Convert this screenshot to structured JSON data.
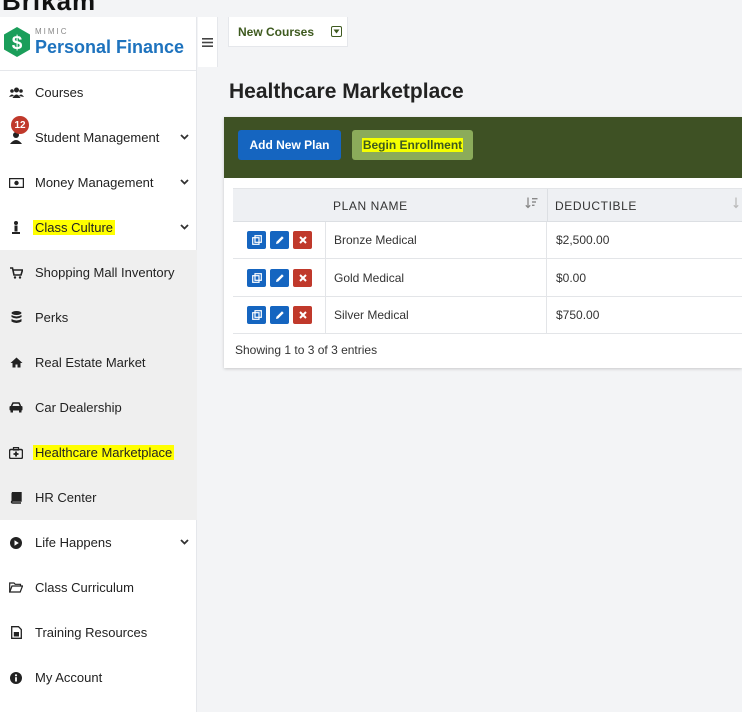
{
  "app": {
    "brand_small": "MIMIC",
    "brand_name": "Personal Finance",
    "cut_logo_text": "Brikam"
  },
  "colors": {
    "brand_blue": "#1e73be",
    "header_green": "#3e5124",
    "highlight": "#ffff00",
    "primary_button": "#1565c0",
    "danger": "#c0392b"
  },
  "sidebar": {
    "items": [
      {
        "label": "Courses",
        "icon": "users-icon"
      },
      {
        "label": "Student Management",
        "icon": "user-icon",
        "badge": "12",
        "has_chevron": true
      },
      {
        "label": "Money Management",
        "icon": "money-icon",
        "has_chevron": true
      },
      {
        "label": "Class Culture",
        "icon": "person-icon",
        "has_chevron": true,
        "highlighted": true
      },
      {
        "label": "Shopping Mall Inventory",
        "icon": "cart-icon"
      },
      {
        "label": "Perks",
        "icon": "database-icon"
      },
      {
        "label": "Real Estate Market",
        "icon": "home-icon"
      },
      {
        "label": "Car Dealership",
        "icon": "car-icon"
      },
      {
        "label": "Healthcare Marketplace",
        "icon": "medkit-icon",
        "highlighted": true
      },
      {
        "label": "HR Center",
        "icon": "book-icon"
      },
      {
        "label": "Life Happens",
        "icon": "play-circle-icon",
        "has_chevron": true
      },
      {
        "label": "Class Curriculum",
        "icon": "folder-open-icon"
      },
      {
        "label": "Training Resources",
        "icon": "file-icon"
      },
      {
        "label": "My Account",
        "icon": "info-circle-icon"
      }
    ]
  },
  "tab": {
    "label": "New Courses"
  },
  "main": {
    "title": "Healthcare Marketplace",
    "buttons": {
      "add": "Add New Plan",
      "enroll": "Begin Enrollment"
    },
    "table": {
      "columns": [
        "PLAN NAME",
        "DEDUCTIBLE"
      ],
      "rows": [
        {
          "plan_name": "Bronze Medical",
          "deductible": "$2,500.00"
        },
        {
          "plan_name": "Gold Medical",
          "deductible": "$0.00"
        },
        {
          "plan_name": "Silver Medical",
          "deductible": "$750.00"
        }
      ],
      "info": "Showing 1 to 3 of 3 entries"
    }
  }
}
